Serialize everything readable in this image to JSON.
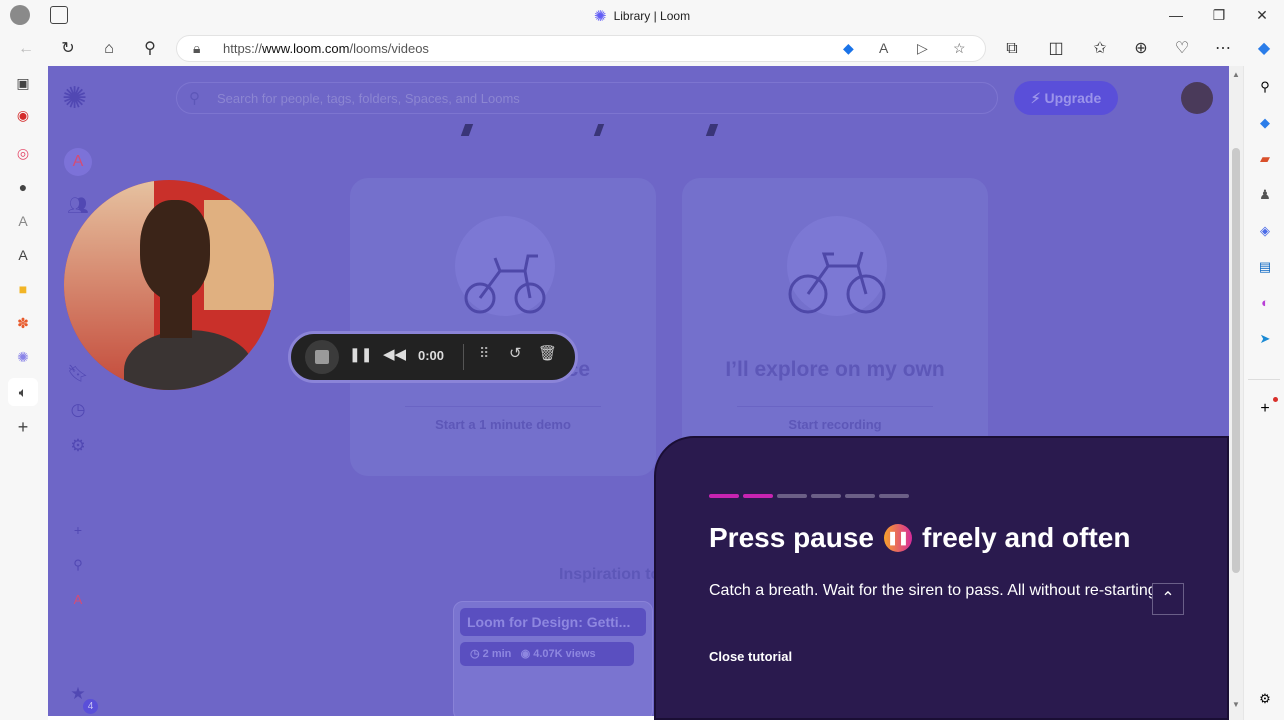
{
  "browser": {
    "tab_title": "Library | Loom",
    "url_prefix": "https://",
    "url_host": "www.loom.com",
    "url_path": "/looms/videos"
  },
  "loom": {
    "search_placeholder": "Search for people, tags, folders, Spaces, and Looms",
    "upgrade_label": "Upgrade",
    "workspace_initial": "A",
    "card_left_title": "ce",
    "card_left_link": "Start a 1 minute demo",
    "card_right_title": "I’ll explore on my own",
    "card_right_link": "Start recording",
    "inspiration_label": "Inspiration to",
    "video_title": "Loom for Design: Getti...",
    "video_duration": "2 min",
    "video_views": "4.07K views",
    "notification_count": "4"
  },
  "recorder": {
    "timer": "0:00"
  },
  "tutorial": {
    "title_before": "Press pause",
    "title_after": "freely and often",
    "text": "Catch a breath. Wait for the siren to pass. All without re-starting.",
    "close_label": "Close tutorial",
    "progress_active": 2,
    "progress_total": 6,
    "accent_color": "#c724b1"
  }
}
